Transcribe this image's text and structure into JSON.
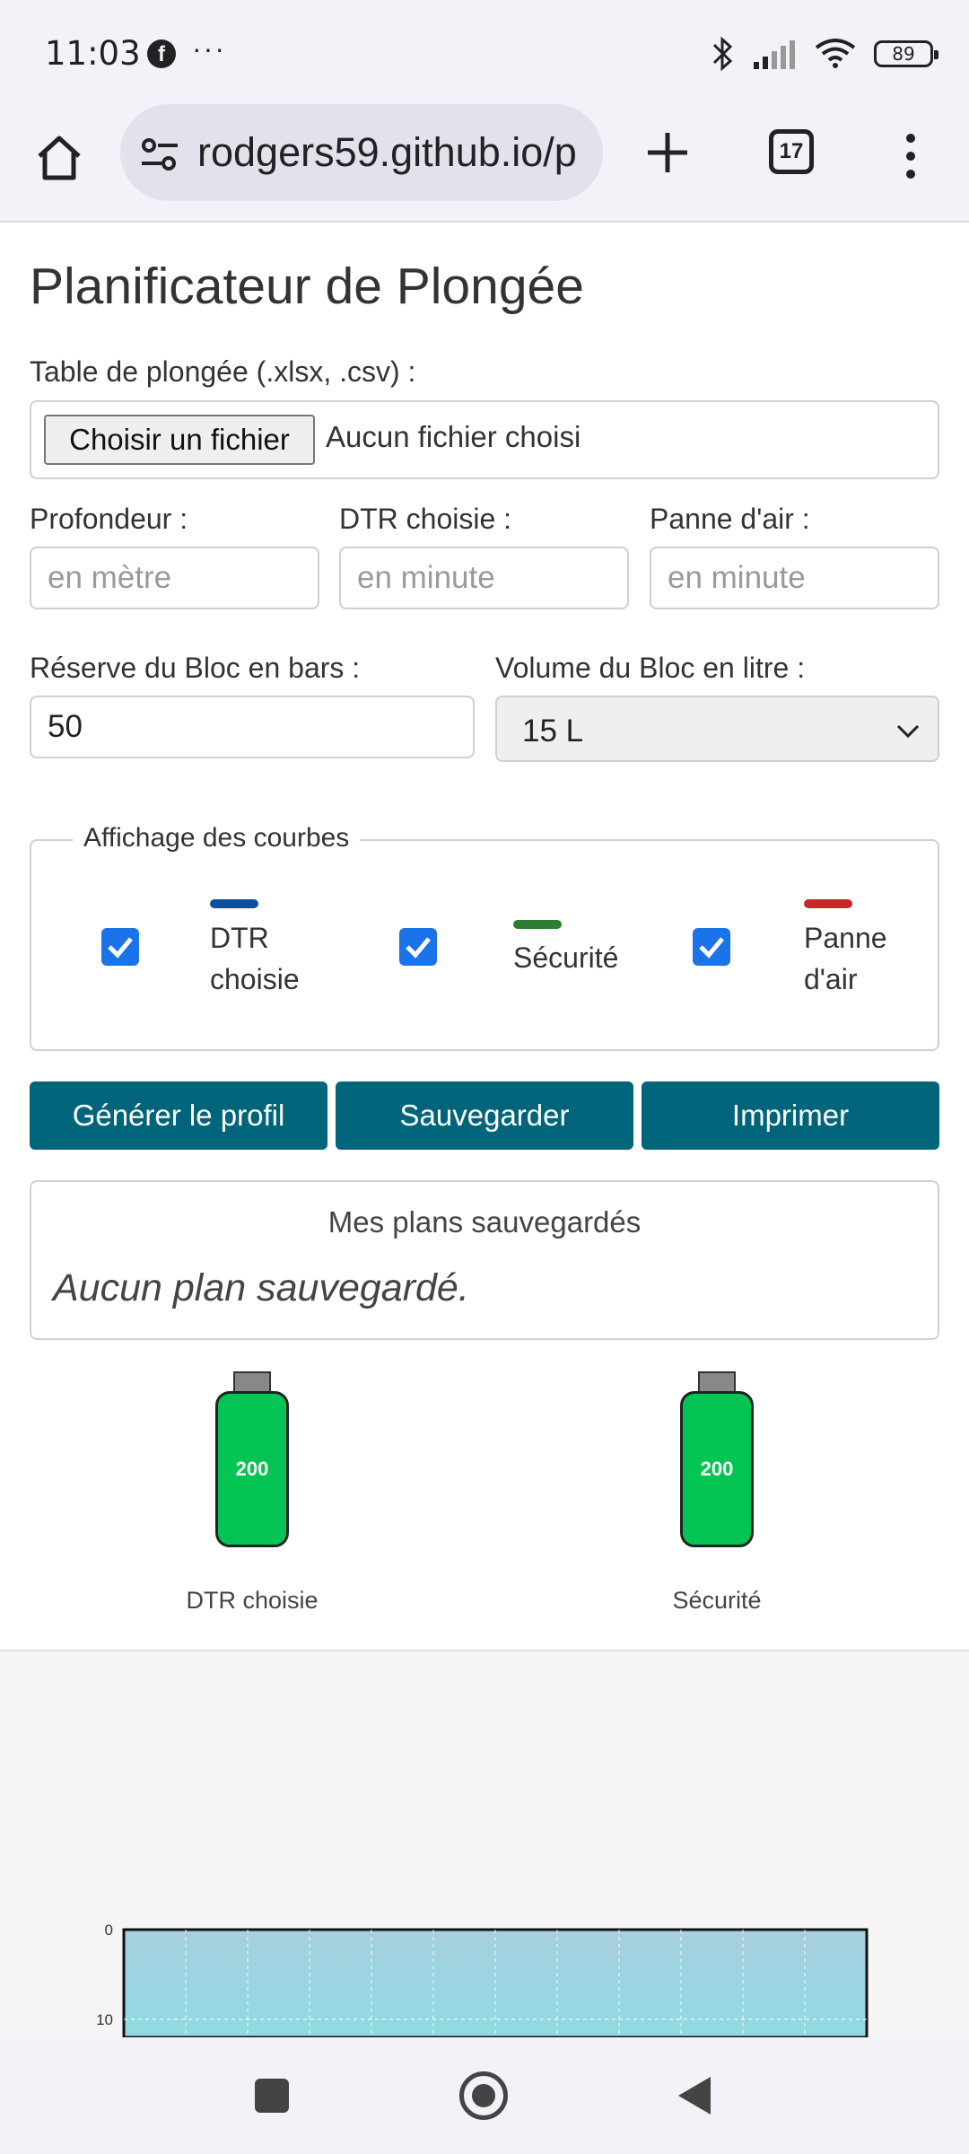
{
  "status_bar": {
    "time": "11:03",
    "facebook_icon": "f",
    "more": "···",
    "battery": "89"
  },
  "browser": {
    "url": "rodgers59.github.io/p",
    "tab_count": "17"
  },
  "page": {
    "title": "Planificateur de Plongée",
    "file_label": "Table de plongée (.xlsx, .csv) :",
    "file_button": "Choisir un fichier",
    "file_status": "Aucun fichier choisi",
    "depth_label": "Profondeur :",
    "depth_placeholder": "en mètre",
    "dtr_label": "DTR choisie :",
    "dtr_placeholder": "en minute",
    "air_label": "Panne d'air :",
    "air_placeholder": "en minute",
    "reserve_label": "Réserve du Bloc en bars :",
    "reserve_value": "50",
    "volume_label": "Volume du Bloc en litre :",
    "volume_value": "15 L",
    "curves_legend": "Affichage des courbes",
    "curves": [
      {
        "label_line1": "DTR",
        "label_line2": "choisie",
        "color": "#0d4f9a",
        "checked": true
      },
      {
        "label_line1": "Sécurité",
        "label_line2": "",
        "color": "#2e7d32",
        "checked": true
      },
      {
        "label_line1": "Panne",
        "label_line2": "d'air",
        "color": "#c62828",
        "checked": true
      }
    ],
    "buttons": {
      "generate": "Générer le profil",
      "save": "Sauvegarder",
      "print": "Imprimer"
    },
    "saved_title": "Mes plans sauvegardés",
    "saved_empty": "Aucun plan sauvegardé.",
    "tanks": [
      {
        "pressure": "200",
        "label": "DTR choisie",
        "color": "#04c453"
      },
      {
        "pressure": "200",
        "label": "Sécurité",
        "color": "#04c453"
      }
    ]
  },
  "chart_data": {
    "type": "area",
    "y_ticks": [
      "0",
      "10"
    ],
    "ylim": [
      0,
      10
    ],
    "grid": true
  }
}
